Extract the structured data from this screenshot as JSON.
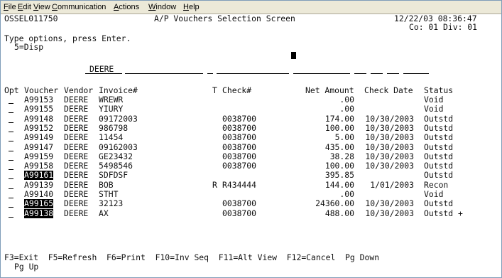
{
  "menu": [
    "File",
    "Edit",
    "View",
    "Communication",
    "Actions",
    "Window",
    "Help"
  ],
  "header": {
    "program": "OSSEL011750",
    "title": "A/P Vouchers Selection Screen",
    "datetime": "12/22/03 08:36:47",
    "company": "Co: 01 Div: 01"
  },
  "instructions": {
    "line1": "Type options, press Enter.",
    "line2": "5=Disp"
  },
  "filter": {
    "vendor": "DEERE"
  },
  "columns": {
    "opt": "Opt",
    "voucher": "Voucher",
    "vendor": "Vendor",
    "invoice": "Invoice#",
    "t": "T",
    "check": "Check#",
    "net": "Net Amount",
    "check_date": "Check Date",
    "status": "Status"
  },
  "rows": [
    {
      "voucher": "A99153",
      "vendor": "DEERE",
      "invoice": "WREWR",
      "t": "",
      "check": "",
      "net": ".00",
      "check_date": "",
      "status": "Void",
      "hl": false
    },
    {
      "voucher": "A99155",
      "vendor": "DEERE",
      "invoice": "YIURY",
      "t": "",
      "check": "",
      "net": ".00",
      "check_date": "",
      "status": "Void",
      "hl": false
    },
    {
      "voucher": "A99148",
      "vendor": "DEERE",
      "invoice": "09172003",
      "t": "",
      "check": "0038700",
      "net": "174.00",
      "check_date": "10/30/2003",
      "status": "Outstd",
      "hl": false
    },
    {
      "voucher": "A99152",
      "vendor": "DEERE",
      "invoice": "986798",
      "t": "",
      "check": "0038700",
      "net": "100.00",
      "check_date": "10/30/2003",
      "status": "Outstd",
      "hl": false
    },
    {
      "voucher": "A99149",
      "vendor": "DEERE",
      "invoice": "11454",
      "t": "",
      "check": "0038700",
      "net": "5.00",
      "check_date": "10/30/2003",
      "status": "Outstd",
      "hl": false
    },
    {
      "voucher": "A99147",
      "vendor": "DEERE",
      "invoice": "09162003",
      "t": "",
      "check": "0038700",
      "net": "435.00",
      "check_date": "10/30/2003",
      "status": "Outstd",
      "hl": false
    },
    {
      "voucher": "A99159",
      "vendor": "DEERE",
      "invoice": "GE23432",
      "t": "",
      "check": "0038700",
      "net": "38.28",
      "check_date": "10/30/2003",
      "status": "Outstd",
      "hl": false
    },
    {
      "voucher": "A99158",
      "vendor": "DEERE",
      "invoice": "5498546",
      "t": "",
      "check": "0038700",
      "net": "100.00",
      "check_date": "10/30/2003",
      "status": "Outstd",
      "hl": false
    },
    {
      "voucher": "A99161",
      "vendor": "DEERE",
      "invoice": "SDFDSF",
      "t": "",
      "check": "",
      "net": "395.85",
      "check_date": "",
      "status": "Outstd",
      "hl": true
    },
    {
      "voucher": "A99139",
      "vendor": "DEERE",
      "invoice": "BOB",
      "t": "R",
      "check": "R434444",
      "net": "144.00",
      "check_date": "1/01/2003",
      "status": "Recon",
      "hl": false
    },
    {
      "voucher": "A99140",
      "vendor": "DEERE",
      "invoice": "STHT",
      "t": "",
      "check": "",
      "net": ".00",
      "check_date": "",
      "status": "Void",
      "hl": false
    },
    {
      "voucher": "A99165",
      "vendor": "DEERE",
      "invoice": "32123",
      "t": "",
      "check": "0038700",
      "net": "24360.00",
      "check_date": "10/30/2003",
      "status": "Outstd",
      "hl": true
    },
    {
      "voucher": "A99138",
      "vendor": "DEERE",
      "invoice": "AX",
      "t": "",
      "check": "0038700",
      "net": "488.00",
      "check_date": "10/30/2003",
      "status": "Outstd +",
      "hl": true
    }
  ],
  "fkeys": {
    "line1": "F3=Exit  F5=Refresh  F6=Print  F10=Inv Seq  F11=Alt View  F12=Cancel  Pg Down",
    "line2": "Pg Up"
  }
}
